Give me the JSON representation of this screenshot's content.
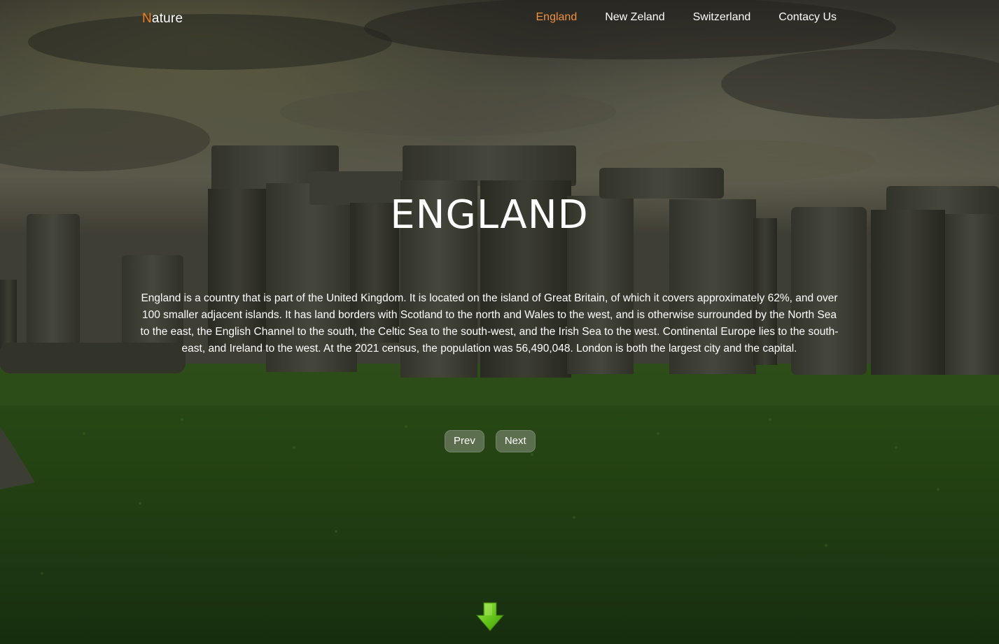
{
  "nav": {
    "brand_first": "N",
    "brand_rest": "ature",
    "links": [
      {
        "label": "England",
        "active": true
      },
      {
        "label": "New Zeland",
        "active": false
      },
      {
        "label": "Switzerland",
        "active": false
      },
      {
        "label": "Contacy Us",
        "active": false
      }
    ]
  },
  "hero": {
    "title": "ENGLAND",
    "description": "England is a country that is part of the United Kingdom. It is located on the island of Great Britain, of which it covers approximately 62%, and over 100 smaller adjacent islands. It has land borders with Scotland to the north and Wales to the west, and is otherwise surrounded by the North Sea to the east, the English Channel to the south, the Celtic Sea to the south-west, and the Irish Sea to the west. Continental Europe lies to the south-east, and Ireland to the west. At the 2021 census, the population was 56,490,048. London is both the largest city and the capital."
  },
  "buttons": {
    "prev_label": "Prev",
    "next_label": "Next"
  },
  "icons": {
    "scroll_down": "down-arrow-icon"
  },
  "colors": {
    "accent": "#f07c24",
    "nav_active": "#f0923c",
    "text": "#ffffff",
    "arrow": "#6fcf1f"
  }
}
